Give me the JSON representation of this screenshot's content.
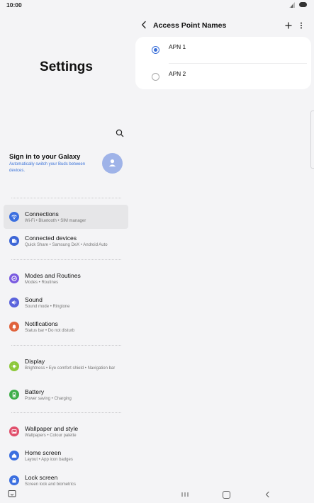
{
  "status": {
    "time": "10:00"
  },
  "left": {
    "title": "Settings",
    "signin": {
      "title": "Sign in to your Galaxy",
      "subtitle": "Automatically switch your Buds between devices."
    },
    "items": [
      {
        "title": "Connections",
        "subtitle": "Wi-Fi  •  Bluetooth  •  SIM manager",
        "color": "#3b6fe0",
        "icon": "wifi-icon"
      },
      {
        "title": "Connected devices",
        "subtitle": "Quick Share  •  Samsung DeX  •  Android Auto",
        "color": "#3d66d6",
        "icon": "devices-icon"
      },
      {
        "title": "Modes and Routines",
        "subtitle": "Modes  •  Routines",
        "color": "#7a5be0",
        "icon": "routines-icon"
      },
      {
        "title": "Sound",
        "subtitle": "Sound mode  •  Ringtone",
        "color": "#5a63dc",
        "icon": "sound-icon"
      },
      {
        "title": "Notifications",
        "subtitle": "Status bar  •  Do not disturb",
        "color": "#e0623b",
        "icon": "bell-icon"
      },
      {
        "title": "Display",
        "subtitle": "Brightness  •  Eye comfort shield  •  Navigation bar",
        "color": "#8dc83a",
        "icon": "sun-icon"
      },
      {
        "title": "Battery",
        "subtitle": "Power saving  •  Charging",
        "color": "#3fae4a",
        "icon": "battery-icon"
      },
      {
        "title": "Wallpaper and style",
        "subtitle": "Wallpapers  •  Colour palette",
        "color": "#e04f6c",
        "icon": "wallpaper-icon"
      },
      {
        "title": "Home screen",
        "subtitle": "Layout  •  App icon badges",
        "color": "#3b6fe0",
        "icon": "home-icon"
      },
      {
        "title": "Lock screen",
        "subtitle": "Screen lock and biometrics",
        "color": "#3b6fe0",
        "icon": "lock-icon"
      }
    ]
  },
  "right": {
    "header": {
      "title": "Access Point Names"
    },
    "apns": [
      {
        "name": "APN 1",
        "selected": true
      },
      {
        "name": "APN 2",
        "selected": false
      }
    ]
  },
  "colors": {
    "accent": "#3a6fd8",
    "background": "#f4f4f6",
    "card": "#ffffff"
  }
}
